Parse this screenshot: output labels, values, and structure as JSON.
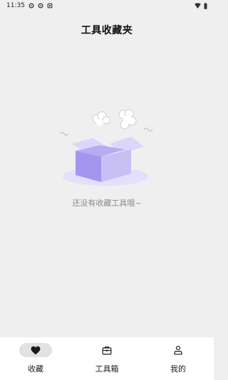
{
  "status_bar": {
    "time": "11:35",
    "left_icons": [
      "settings-icon",
      "settings-icon",
      "notification-icon"
    ],
    "right_icons": [
      "wifi-icon",
      "battery-icon"
    ]
  },
  "header": {
    "title": "工具收藏夹"
  },
  "empty_state": {
    "illustration": "empty-box",
    "message": "还没有收藏工具哦~",
    "colors": {
      "box_front": "#a495f0",
      "box_side": "#c8bff5",
      "box_lid": "#ddd6fb",
      "shadow": "#e4e0fb"
    }
  },
  "bottom_nav": {
    "items": [
      {
        "label": "收藏",
        "icon": "heart-icon",
        "active": true
      },
      {
        "label": "工具箱",
        "icon": "toolbox-icon",
        "active": false
      },
      {
        "label": "我的",
        "icon": "person-icon",
        "active": false
      }
    ]
  }
}
